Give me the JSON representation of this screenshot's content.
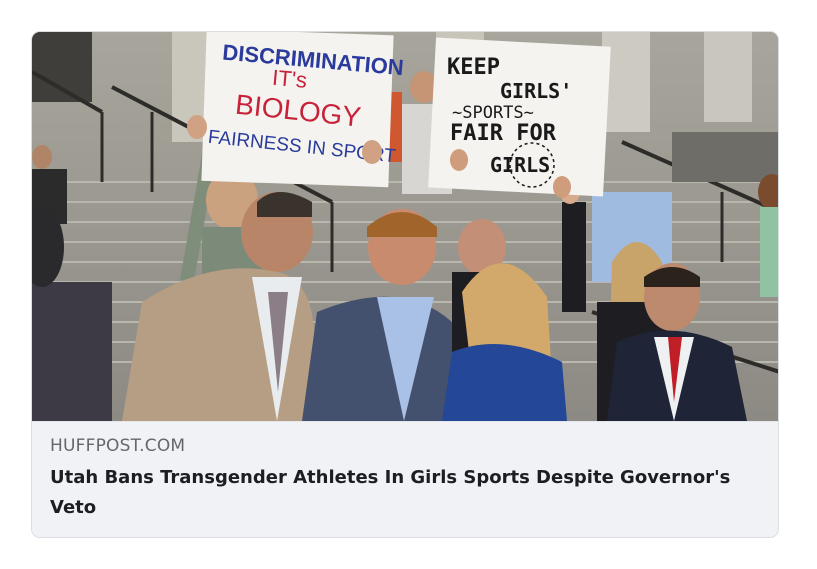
{
  "link_card": {
    "domain": "HUFFPOST.COM",
    "headline": "Utah Bans Transgender Athletes In Girls Sports Despite Governor's Veto"
  },
  "photo": {
    "subject": "protest-on-capitol-steps",
    "sign_left": {
      "line1": "DISCRIMINATION",
      "line2": "IT's",
      "line3": "BIOLOGY",
      "line4": "FAIRNESS IN SPORT"
    },
    "sign_right": {
      "line1": "KEEP",
      "line2": "GIRLS'",
      "line3": "~SPORTS~",
      "line4": "FAIR FOR",
      "line5": "GIRLS"
    }
  }
}
